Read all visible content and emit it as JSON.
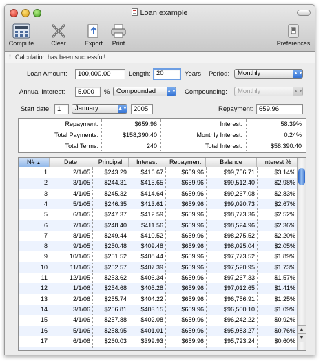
{
  "window": {
    "title": "Loan example"
  },
  "toolbar": {
    "compute": "Compute",
    "clear": "Clear",
    "export": "Export",
    "print": "Print",
    "preferences": "Preferences"
  },
  "status": {
    "icon": "!",
    "message": "Calculation has been successful!"
  },
  "form": {
    "loan_amount_label": "Loan Amount:",
    "loan_amount_value": "100,000.00",
    "length_label": "Length:",
    "length_value": "20",
    "length_unit": "Years",
    "period_label": "Period:",
    "period_value": "Monthly",
    "annual_interest_label": "Annual Interest:",
    "annual_interest_value": "5.000",
    "percent_sign": "%",
    "interest_type_value": "Compounded",
    "compounding_label": "Compounding:",
    "compounding_value": "Monthly",
    "start_date_label": "Start date:",
    "start_day": "1",
    "start_month": "January",
    "start_year": "2005",
    "repayment_label": "Repayment:",
    "repayment_value": "659.96"
  },
  "summary": {
    "rows": [
      {
        "l_label": "Repayment:",
        "l_value": "$659.96",
        "r_label": "Interest:",
        "r_value": "58.39%"
      },
      {
        "l_label": "Total Payments:",
        "l_value": "$158,390.40",
        "r_label": "Monthly Interest:",
        "r_value": "0.24%"
      },
      {
        "l_label": "Total Terms:",
        "l_value": "240",
        "r_label": "Total Interest:",
        "r_value": "$58,390.40"
      }
    ]
  },
  "table": {
    "columns": [
      "N#",
      "Date",
      "Principal",
      "Interest",
      "Repayment",
      "Balance",
      "Interest %"
    ],
    "sort_indicator": "▲",
    "rows": [
      [
        "1",
        "2/1/05",
        "$243.29",
        "$416.67",
        "$659.96",
        "$99,756.71",
        "$3.14%"
      ],
      [
        "2",
        "3/1/05",
        "$244.31",
        "$415.65",
        "$659.96",
        "$99,512.40",
        "$2.98%"
      ],
      [
        "3",
        "4/1/05",
        "$245.32",
        "$414.64",
        "$659.96",
        "$99,267.08",
        "$2.83%"
      ],
      [
        "4",
        "5/1/05",
        "$246.35",
        "$413.61",
        "$659.96",
        "$99,020.73",
        "$2.67%"
      ],
      [
        "5",
        "6/1/05",
        "$247.37",
        "$412.59",
        "$659.96",
        "$98,773.36",
        "$2.52%"
      ],
      [
        "6",
        "7/1/05",
        "$248.40",
        "$411.56",
        "$659.96",
        "$98,524.96",
        "$2.36%"
      ],
      [
        "7",
        "8/1/05",
        "$249.44",
        "$410.52",
        "$659.96",
        "$98,275.52",
        "$2.20%"
      ],
      [
        "8",
        "9/1/05",
        "$250.48",
        "$409.48",
        "$659.96",
        "$98,025.04",
        "$2.05%"
      ],
      [
        "9",
        "10/1/05",
        "$251.52",
        "$408.44",
        "$659.96",
        "$97,773.52",
        "$1.89%"
      ],
      [
        "10",
        "11/1/05",
        "$252.57",
        "$407.39",
        "$659.96",
        "$97,520.95",
        "$1.73%"
      ],
      [
        "11",
        "12/1/05",
        "$253.62",
        "$406.34",
        "$659.96",
        "$97,267.33",
        "$1.57%"
      ],
      [
        "12",
        "1/1/06",
        "$254.68",
        "$405.28",
        "$659.96",
        "$97,012.65",
        "$1.41%"
      ],
      [
        "13",
        "2/1/06",
        "$255.74",
        "$404.22",
        "$659.96",
        "$96,756.91",
        "$1.25%"
      ],
      [
        "14",
        "3/1/06",
        "$256.81",
        "$403.15",
        "$659.96",
        "$96,500.10",
        "$1.09%"
      ],
      [
        "15",
        "4/1/06",
        "$257.88",
        "$402.08",
        "$659.96",
        "$96,242.22",
        "$0.92%"
      ],
      [
        "16",
        "5/1/06",
        "$258.95",
        "$401.01",
        "$659.96",
        "$95,983.27",
        "$0.76%"
      ],
      [
        "17",
        "6/1/06",
        "$260.03",
        "$399.93",
        "$659.96",
        "$95,723.24",
        "$0.60%"
      ]
    ]
  }
}
